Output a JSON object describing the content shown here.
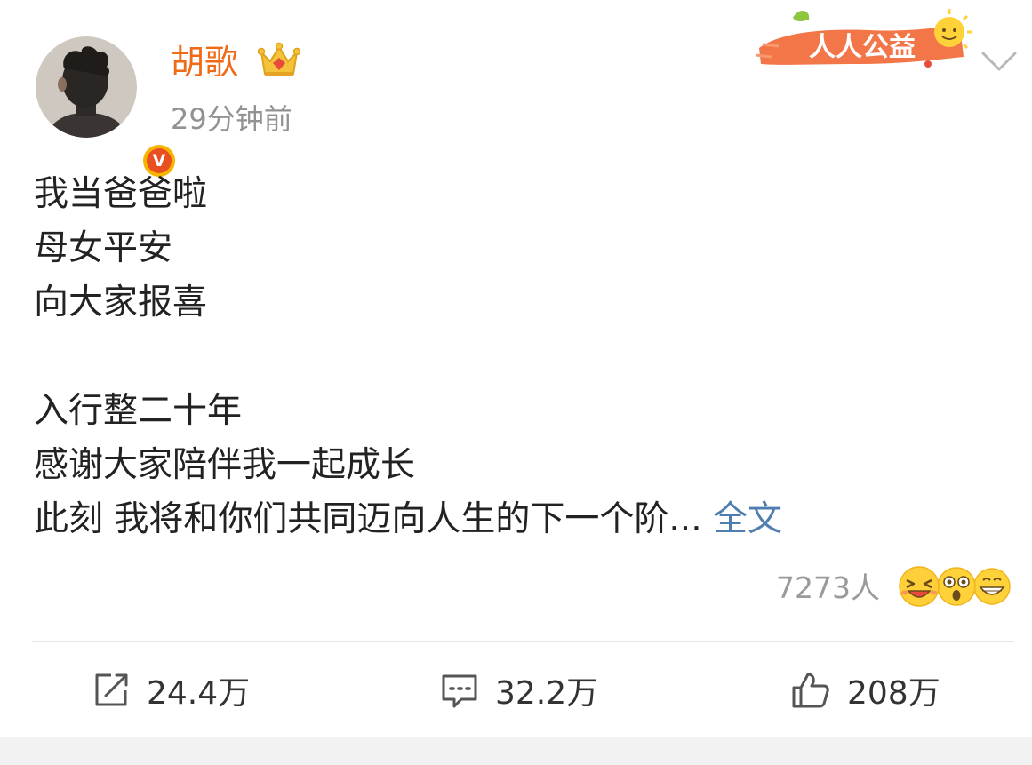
{
  "post": {
    "username": "胡歌",
    "time": "29分钟前",
    "charity_label": "人人公益",
    "verified_badge": "V",
    "lines": [
      "我当爸爸啦",
      "母女平安",
      "向大家报喜",
      "",
      "入行整二十年",
      "感谢大家陪伴我一起成长"
    ],
    "last_line": "此刻 我将和你们共同迈向人生的下一个阶...",
    "full_text_link": "全文",
    "reaction_count": "7273人"
  },
  "actions": {
    "repost_count": "24.4万",
    "comment_count": "32.2万",
    "like_count": "208万"
  },
  "colors": {
    "username": "#f06b18",
    "link": "#507daf",
    "muted": "#929292",
    "badge": "#f7b500"
  },
  "icons": [
    "crown-icon",
    "verified-v-icon",
    "chevron-down-icon",
    "repost-icon",
    "comment-icon",
    "like-icon",
    "laugh-emoji-icon",
    "shock-emoji-icon",
    "grin-emoji-icon"
  ]
}
